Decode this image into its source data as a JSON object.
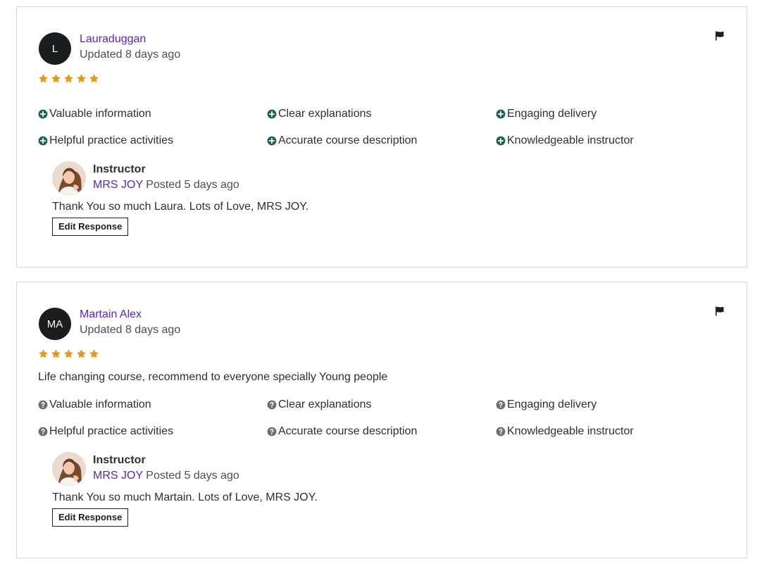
{
  "colors": {
    "link": "#5624d0",
    "star": "#e59819",
    "positive_icon": "#1e6055",
    "neutral_icon": "#6a6f73"
  },
  "reviews": [
    {
      "avatar_initials": "L",
      "reviewer_name": "Lauraduggan",
      "updated": "Updated 8 days ago",
      "rating": 5,
      "review_text": "",
      "feedback_icon": "plus-circle-icon",
      "feedback": [
        "Valuable information",
        "Clear explanations",
        "Engaging delivery",
        "Helpful practice activities",
        "Accurate course description",
        "Knowledgeable instructor"
      ],
      "response": {
        "role": "Instructor",
        "instructor_name": "MRS JOY",
        "posted": "Posted 5 days ago",
        "text": "Thank You so much Laura. Lots of Love, MRS JOY.",
        "edit_label": "Edit Response"
      }
    },
    {
      "avatar_initials": "MA",
      "reviewer_name": "Martain Alex",
      "updated": "Updated 8 days ago",
      "rating": 5,
      "review_text": "Life changing course, recommend to everyone specially Young people",
      "feedback_icon": "question-circle-icon",
      "feedback": [
        "Valuable information",
        "Clear explanations",
        "Engaging delivery",
        "Helpful practice activities",
        "Accurate course description",
        "Knowledgeable instructor"
      ],
      "response": {
        "role": "Instructor",
        "instructor_name": "MRS JOY",
        "posted": "Posted 5 days ago",
        "text": "Thank You so much Martain. Lots of Love, MRS JOY.",
        "edit_label": "Edit Response"
      }
    }
  ]
}
